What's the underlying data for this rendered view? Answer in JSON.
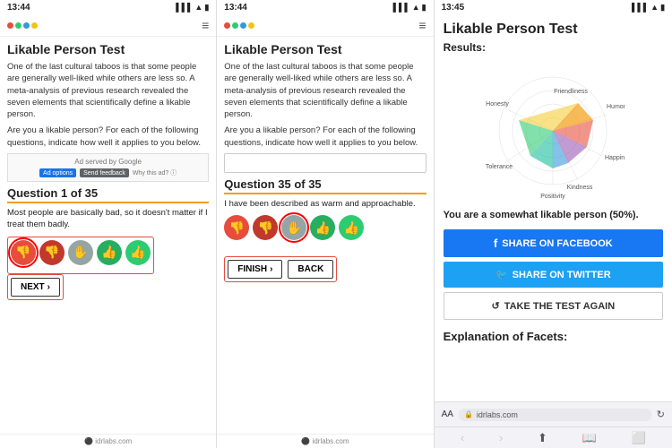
{
  "panel1": {
    "status_time": "13:44",
    "title": "Likable Person Test",
    "description1": "One of the last cultural taboos is that some people are generally well-liked while others are less so. A meta-analysis of previous research revealed the seven elements that scientifically define a likable person.",
    "description2": "Are you a likable person? For each of the following questions, indicate how well it applies to you below.",
    "ad_text": "Ad served by Google",
    "ad_btn1": "Ad options",
    "ad_btn2": "Send feedback",
    "ad_btn3": "Why this ad? ⓘ",
    "question_header": "Question 1 of 35",
    "question_text": "Most people are basically bad, so it doesn't matter if I treat them badly.",
    "next_label": "NEXT",
    "footer": "⚫ idrlabs.com"
  },
  "panel2": {
    "status_time": "13:44",
    "title": "Likable Person Test",
    "description1": "One of the last cultural taboos is that some people are generally well-liked while others are less so. A meta-analysis of previous research revealed the seven elements that scientifically define a likable person.",
    "description2": "Are you a likable person? For each of the following questions, indicate how well it applies to you below.",
    "question_header": "Question 35 of 35",
    "question_text": "I have been described as warm and approachable.",
    "finish_label": "FINISH",
    "back_label": "BACK",
    "footer": "⚫ idrlabs.com"
  },
  "panel3": {
    "status_time": "13:45",
    "title": "Likable Person Test",
    "results_label": "Results:",
    "radar_labels": [
      "Friendliness",
      "Humor",
      "Happiness",
      "Kindness",
      "Positivity",
      "Tolerance",
      "Honesty"
    ],
    "result_text": "You are a somewhat likable person (50%).",
    "share_facebook": "SHARE ON FACEBOOK",
    "share_twitter": "SHARE ON TWITTER",
    "retake": "TAKE THE TEST AGAIN",
    "explanation_header": "Explanation of Facets:",
    "browser_aa": "AA",
    "browser_url": "idrlabs.com",
    "facebook_icon": "f",
    "twitter_icon": "🐦"
  }
}
